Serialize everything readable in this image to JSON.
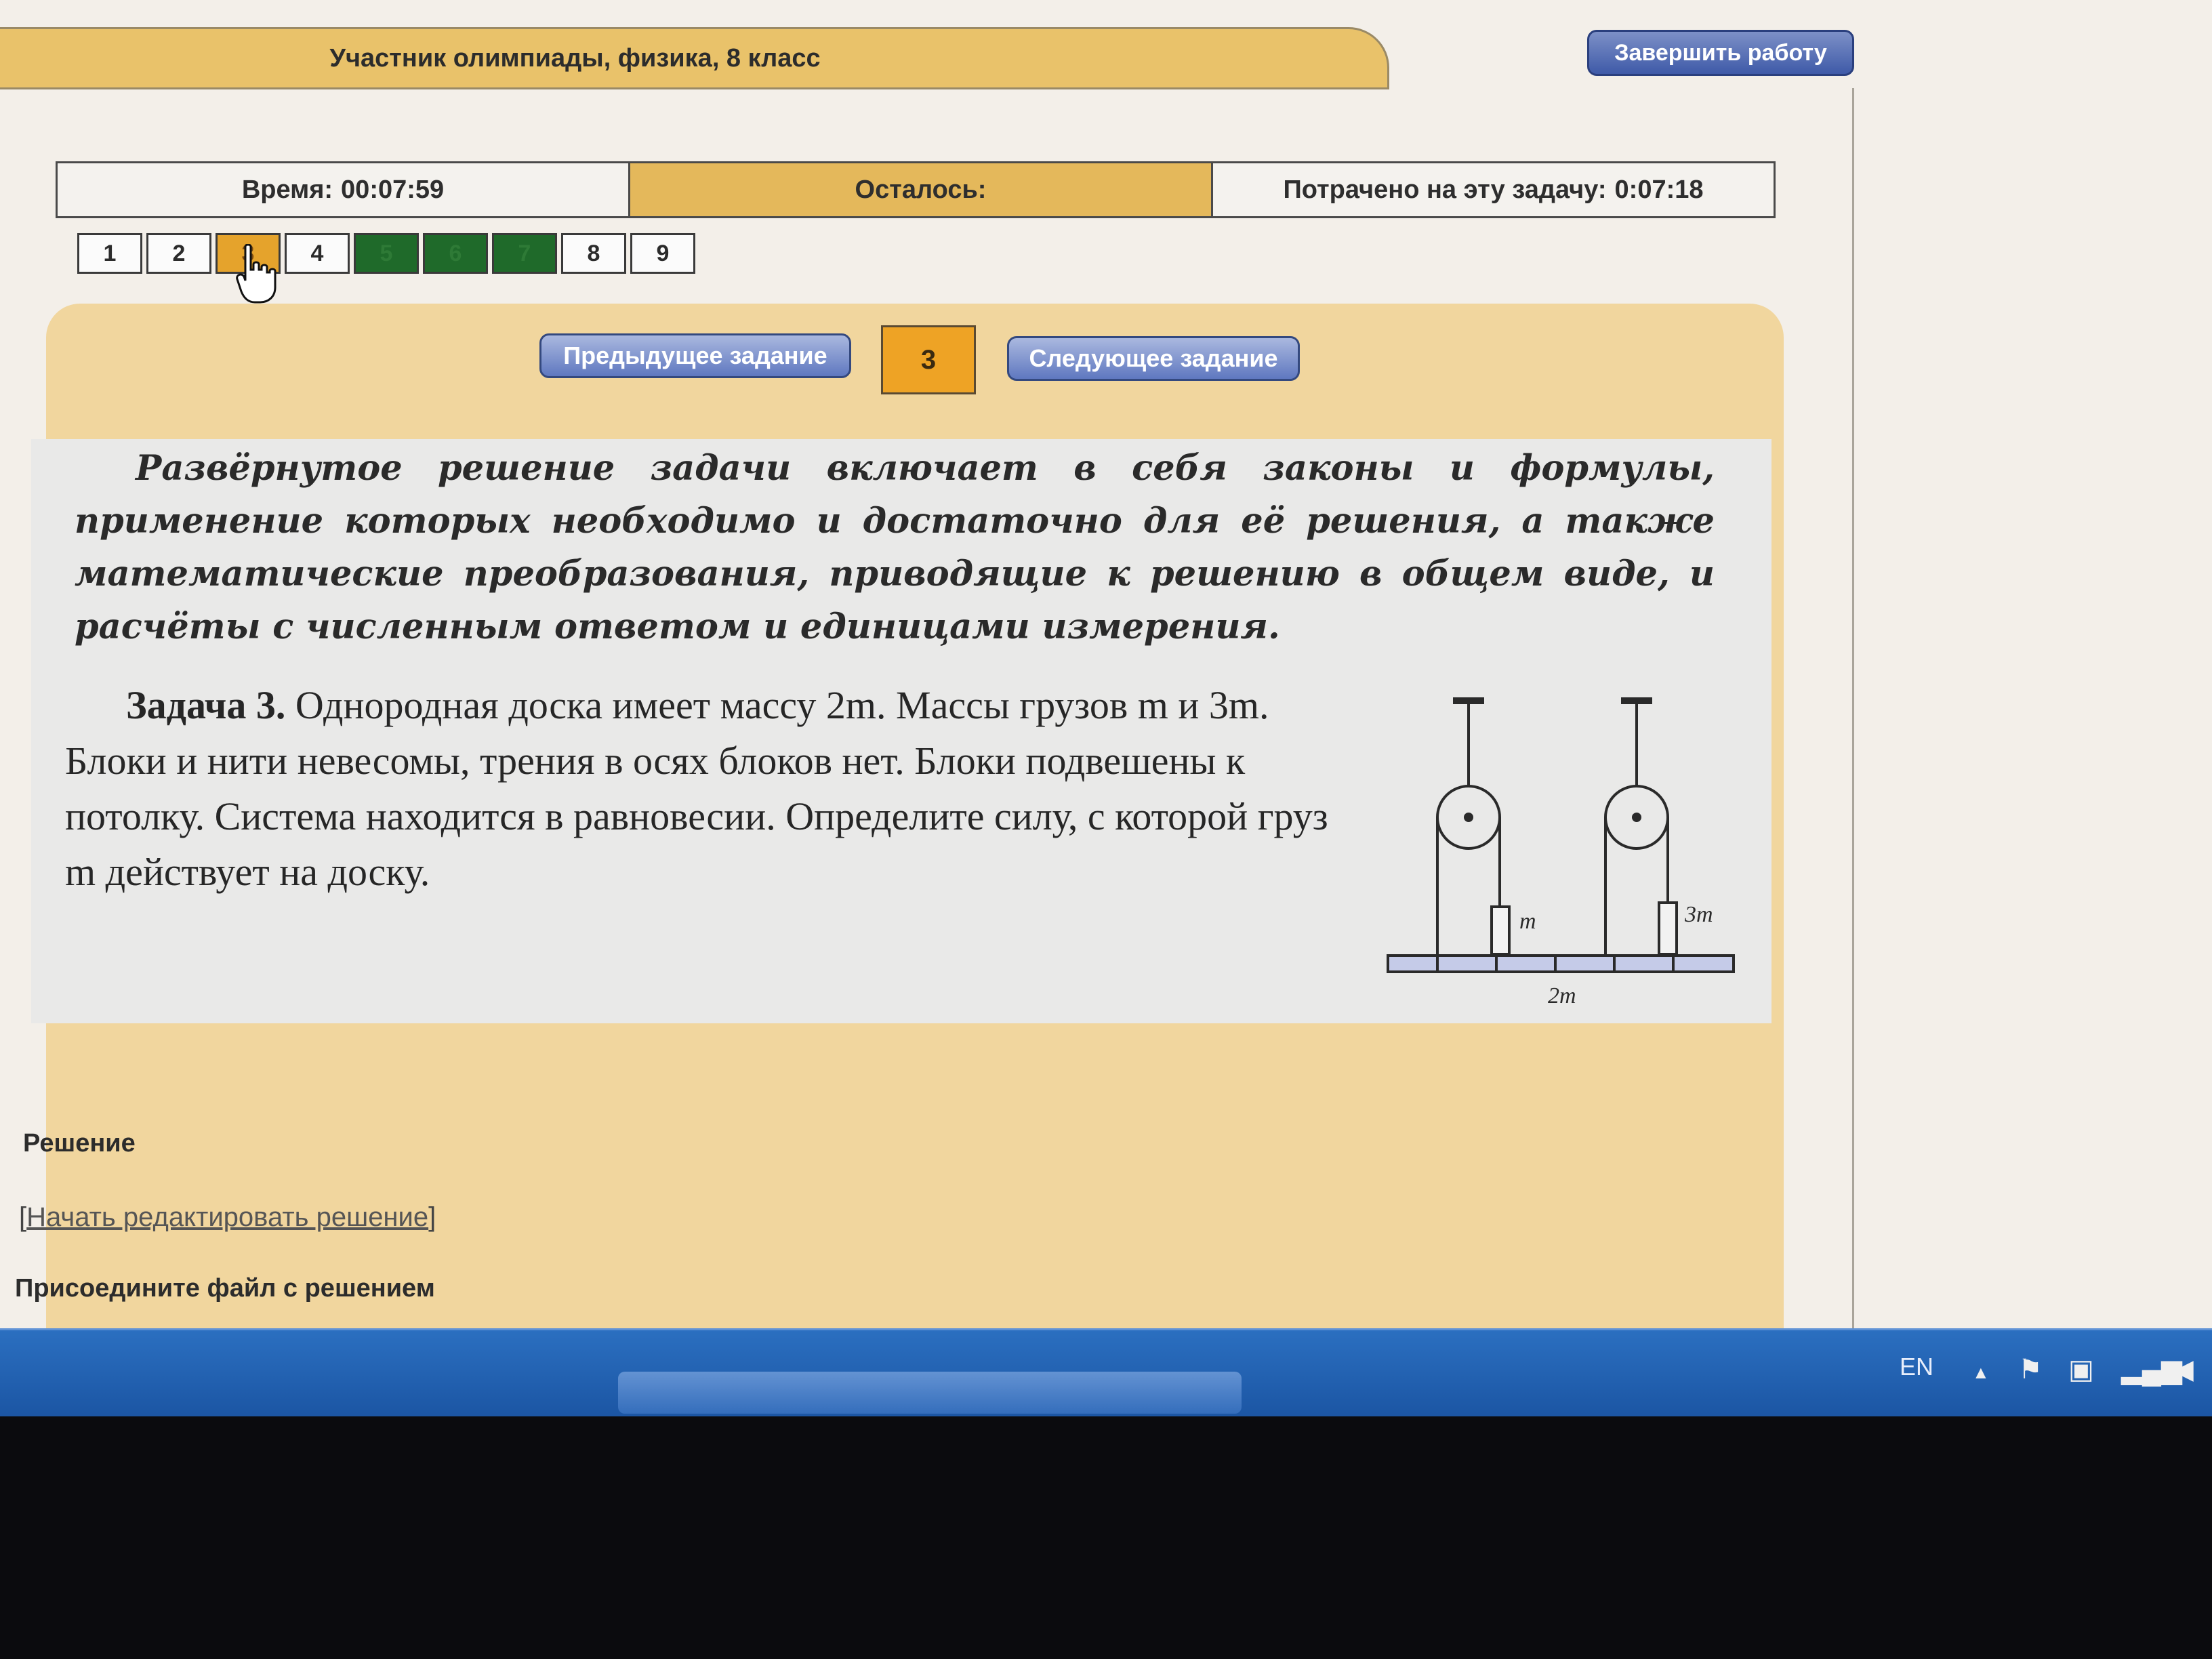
{
  "header": {
    "title": "Участник олимпиады, физика, 8 класс",
    "finish_button": "Завершить работу"
  },
  "timebar": {
    "time_label": "Время:",
    "time_value": "00:07:59",
    "remaining_label": "Осталось:",
    "spent_label": "Потрачено на эту задачу:",
    "spent_value": "0:07:18"
  },
  "tasks": [
    {
      "label": "1",
      "state": "normal"
    },
    {
      "label": "2",
      "state": "normal"
    },
    {
      "label": "3",
      "state": "current"
    },
    {
      "label": "4",
      "state": "normal"
    },
    {
      "label": "5",
      "state": "done"
    },
    {
      "label": "6",
      "state": "done"
    },
    {
      "label": "7",
      "state": "done"
    },
    {
      "label": "8",
      "state": "normal"
    },
    {
      "label": "9",
      "state": "normal"
    }
  ],
  "navigation": {
    "prev_label": "Предыдущее задание",
    "current_number": "3",
    "next_label": "Следующее задание"
  },
  "instruction": "Развёрнутое решение задачи включает в себя законы и формулы, применение которых необходимо и достаточно для её решения, а также математические преобразования, приводящие к решению в общем виде, и расчёты с численным ответом и единицами измерения.",
  "problem": {
    "label": "Задача 3.",
    "text": "Однородная доска имеет массу 2m. Массы грузов m и 3m. Блоки и нити невесомы, трения в осях блоков нет. Блоки подвешены к потолку. Система находится в равновесии. Определите силу, с которой груз m действует на доску."
  },
  "diagram": {
    "label_left_weight": "m",
    "label_right_weight": "3m",
    "label_board": "2m"
  },
  "solution": {
    "title": "Решение",
    "edit_link": "Начать редактировать решение",
    "attach_title": "Присоедините файл с решением"
  },
  "taskbar": {
    "language": "EN"
  },
  "colors": {
    "header_tab": "#e9c26a",
    "accent_button": "#3f5aa8",
    "current_task": "#e5a32c",
    "done_task": "#1f6a2a",
    "panel": "#f1d69e",
    "taskbar": "#1b55a3"
  }
}
